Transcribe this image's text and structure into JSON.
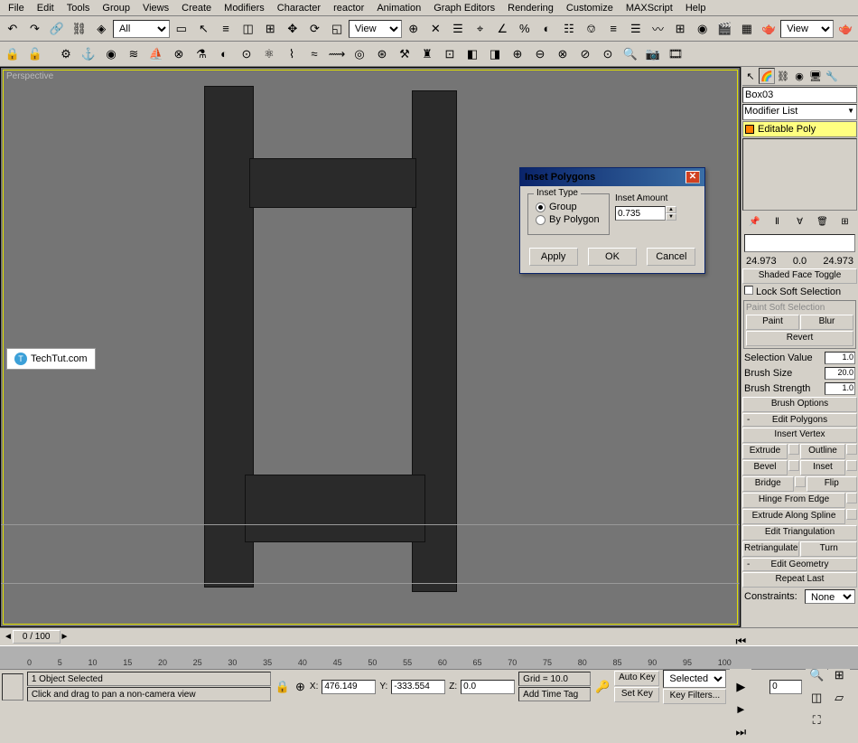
{
  "menu": {
    "items": [
      "File",
      "Edit",
      "Tools",
      "Group",
      "Views",
      "Create",
      "Modifiers",
      "Character",
      "reactor",
      "Animation",
      "Graph Editors",
      "Rendering",
      "Customize",
      "MAXScript",
      "Help"
    ]
  },
  "toolbar1": {
    "layer_sel": "All",
    "view_sel": "View",
    "view_sel2": "View"
  },
  "viewport": {
    "label": "Perspective",
    "watermark": "TechTut.com"
  },
  "dialog": {
    "title": "Inset Polygons",
    "group1": "Inset Type",
    "opt1": "Group",
    "opt2": "By Polygon",
    "label2": "Inset Amount",
    "value": "0.735",
    "btn_apply": "Apply",
    "btn_ok": "OK",
    "btn_cancel": "Cancel"
  },
  "panel": {
    "objname": "Box03",
    "modlist": "Modifier List",
    "stack_item": "Editable Poly",
    "spin_l": "24.973",
    "spin_c": "0.0",
    "spin_r": "24.973",
    "shaded": "Shaded Face Toggle",
    "locksoft": "Lock Soft Selection",
    "paintsoft": "Paint Soft Selection",
    "paint": "Paint",
    "blur": "Blur",
    "revert": "Revert",
    "selval": "Selection Value",
    "selval_v": "1.0",
    "brushsize": "Brush Size",
    "brushsize_v": "20.0",
    "brushstr": "Brush Strength",
    "brushstr_v": "1.0",
    "brushopt": "Brush Options",
    "roll1": "Edit Polygons",
    "insvert": "Insert Vertex",
    "extrude": "Extrude",
    "outline": "Outline",
    "bevel": "Bevel",
    "inset": "Inset",
    "bridge": "Bridge",
    "flip": "Flip",
    "hinge": "Hinge From Edge",
    "extrspline": "Extrude Along Spline",
    "edittri": "Edit Triangulation",
    "retri": "Retriangulate",
    "turn": "Turn",
    "roll2": "Edit Geometry",
    "repeatlast": "Repeat Last",
    "constraints": "Constraints:",
    "constraints_v": "None"
  },
  "timeline": {
    "frame": "0 / 100",
    "ticks": [
      "0",
      "5",
      "10",
      "15",
      "20",
      "25",
      "30",
      "35",
      "40",
      "45",
      "50",
      "55",
      "60",
      "65",
      "70",
      "75",
      "80",
      "85",
      "90",
      "95",
      "100"
    ]
  },
  "status": {
    "sel": "1 Object Selected",
    "hint": "Click and drag to pan a non-camera view",
    "x": "476.149",
    "y": "-333.554",
    "z": "0.0",
    "grid": "Grid = 10.0",
    "addtime": "Add Time Tag",
    "autokey": "Auto Key",
    "setkey": "Set Key",
    "selected": "Selected",
    "keyfilters": "Key Filters...",
    "frame": "0"
  }
}
